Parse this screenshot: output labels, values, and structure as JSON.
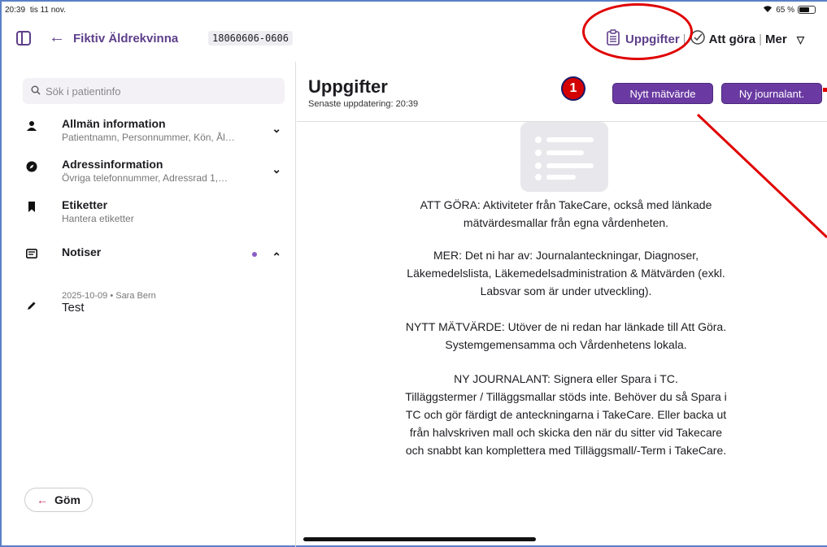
{
  "status_bar": {
    "time": "20:39",
    "date": "tis 11 nov.",
    "wifi": "wifi-icon",
    "battery_text": "65 %",
    "battery_level": 0.65
  },
  "topbar": {
    "back_icon": "arrow-left-icon",
    "patient_name": "Fiktiv Äldrekvinna",
    "personal_number": "18060606-0606",
    "uppgifter_label": "Uppgifter",
    "uppgifter_icon": "clipboard-list-icon",
    "todo_label": "Att göra",
    "todo_icon": "check-circle-icon",
    "more_label": "Mer",
    "more_icon": "chevron-down-icon",
    "separator": "|"
  },
  "sidebar": {
    "search_placeholder": "Sök i patientinfo",
    "items": [
      {
        "icon": "person-icon",
        "title": "Allmän information",
        "subtitle": "Patientnamn, Personnummer, Kön, Ål…",
        "chevron": "chevron-down-icon"
      },
      {
        "icon": "compass-icon",
        "title": "Adressinformation",
        "subtitle": "Övriga telefonnummer, Adressrad 1,…",
        "chevron": "chevron-down-icon"
      },
      {
        "icon": "bookmark-icon",
        "title": "Etiketter",
        "subtitle": "Hantera etiketter"
      },
      {
        "icon": "notes-icon",
        "title": "Notiser",
        "chevron": "chevron-up-icon"
      }
    ],
    "note": {
      "icon": "pencil-icon",
      "meta": "2025-10-09 • Sara Bern",
      "text": "Test"
    },
    "hide_button": "Göm"
  },
  "main": {
    "title": "Uppgifter",
    "updated": "Senaste uppdatering: 20:39",
    "badge": "1",
    "btn_new_value": "Nytt mätvärde",
    "btn_new_journal": "Ny journalant.",
    "paragraphs": [
      [
        "ATT GÖRA: Aktiviteter från TakeCare, också med länkade",
        "mätvärdesmallar från egna vårdenheten."
      ],
      [
        "MER: Det ni har av: Journalanteckningar, Diagnoser,",
        "Läkemedelslista, Läkemedelsadministration & Mätvärden (exkl.",
        "Labsvar som är under utveckling)."
      ],
      [
        "NYTT MÄTVÄRDE: Utöver de ni redan har länkade till Att Göra.",
        "Systemgemensamma och Vårdenhetens lokala."
      ],
      [
        "NY JOURNALANT: Signera eller Spara i TC.",
        "Tilläggstermer / Tilläggsmallar stöds inte. Behöver du så Spara i",
        "TC och gör färdigt de anteckningarna i TakeCare. Eller backa ut",
        "från halvskriven mall och skicka den när du sitter vid Takecare",
        "och snabbt kan komplettera med Tilläggsmall/-Term i TakeCare."
      ]
    ]
  }
}
